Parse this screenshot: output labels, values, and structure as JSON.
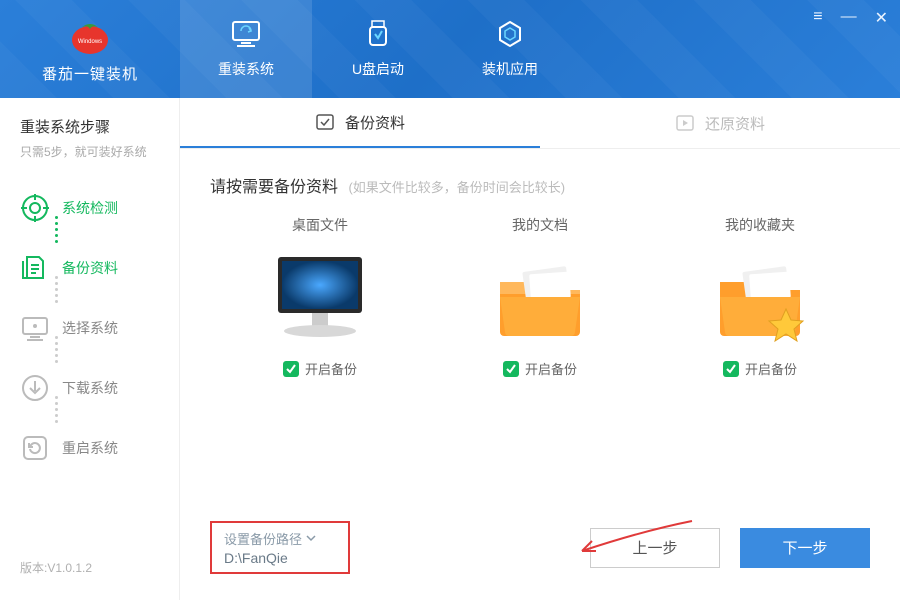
{
  "brand": {
    "name": "番茄一键装机"
  },
  "window_controls": {
    "menu": "≡",
    "min": "—",
    "close": "✕"
  },
  "nav": [
    {
      "label": "重装系统",
      "active": true
    },
    {
      "label": "U盘启动",
      "active": false
    },
    {
      "label": "装机应用",
      "active": false
    }
  ],
  "sidebar": {
    "title": "重装系统步骤",
    "subtitle": "只需5步，就可装好系统",
    "steps": [
      {
        "label": "系统检测",
        "state": "done"
      },
      {
        "label": "备份资料",
        "state": "active"
      },
      {
        "label": "选择系统",
        "state": "pending"
      },
      {
        "label": "下载系统",
        "state": "pending"
      },
      {
        "label": "重启系统",
        "state": "pending"
      }
    ],
    "version": "版本:V1.0.1.2"
  },
  "subtabs": [
    {
      "label": "备份资料",
      "active": true
    },
    {
      "label": "还原资料",
      "active": false
    }
  ],
  "content": {
    "prompt": "请按需要备份资料",
    "prompt_sub": "(如果文件比较多，备份时间会比较长)",
    "cards": [
      {
        "title": "桌面文件",
        "toggle": "开启备份"
      },
      {
        "title": "我的文档",
        "toggle": "开启备份"
      },
      {
        "title": "我的收藏夹",
        "toggle": "开启备份"
      }
    ]
  },
  "footer": {
    "path_label": "设置备份路径",
    "path_value": "D:\\FanQie",
    "btn_prev": "上一步",
    "btn_next": "下一步"
  }
}
